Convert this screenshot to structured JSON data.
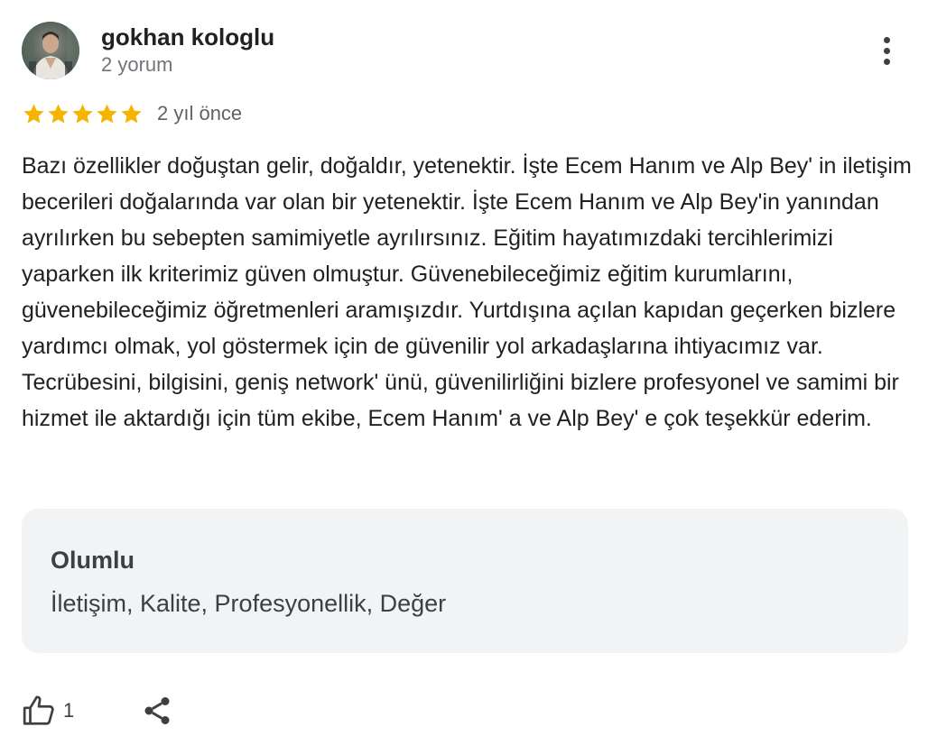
{
  "review": {
    "author_name": "gokhan kologlu",
    "author_review_count": "2 yorum",
    "avatar_icon": "user-avatar-photo",
    "more_icon": "more-vert-icon",
    "rating": 5,
    "rating_max": 5,
    "star_color": "#f4b400",
    "date": "2 yıl önce",
    "text": "Bazı özellikler doğuştan gelir, doğaldır, yetenektir. İşte Ecem Hanım ve Alp Bey' in iletişim becerileri doğalarında var olan bir yetenektir. İşte Ecem Hanım ve Alp Bey'in yanından ayrılırken bu sebepten samimiyetle ayrılırsınız. Eğitim hayatımızdaki tercihlerimizi yaparken ilk kriterimiz güven olmuştur. Güvenebileceğimiz eğitim kurumlarını, güvenebileceğimiz öğretmenleri aramışızdır. Yurtdışına açılan kapıdan geçerken bizlere yardımcı olmak, yol göstermek için de güvenilir yol arkadaşlarına ihtiyacımız var. Tecrübesini, bilgisini, geniş network' ünü, güvenilirliğini bizlere profesyonel ve samimi bir hizmet ile aktardığı için tüm ekibe, Ecem Hanım' a ve Alp Bey' e çok teşekkür ederim.",
    "attributes": {
      "title": "Olumlu",
      "values": "İletişim, Kalite, Profesyonellik, Değer",
      "background": "#f1f3f4"
    },
    "actions": {
      "like_icon": "thumb-up-icon",
      "like_count": "1",
      "share_icon": "share-icon"
    }
  }
}
